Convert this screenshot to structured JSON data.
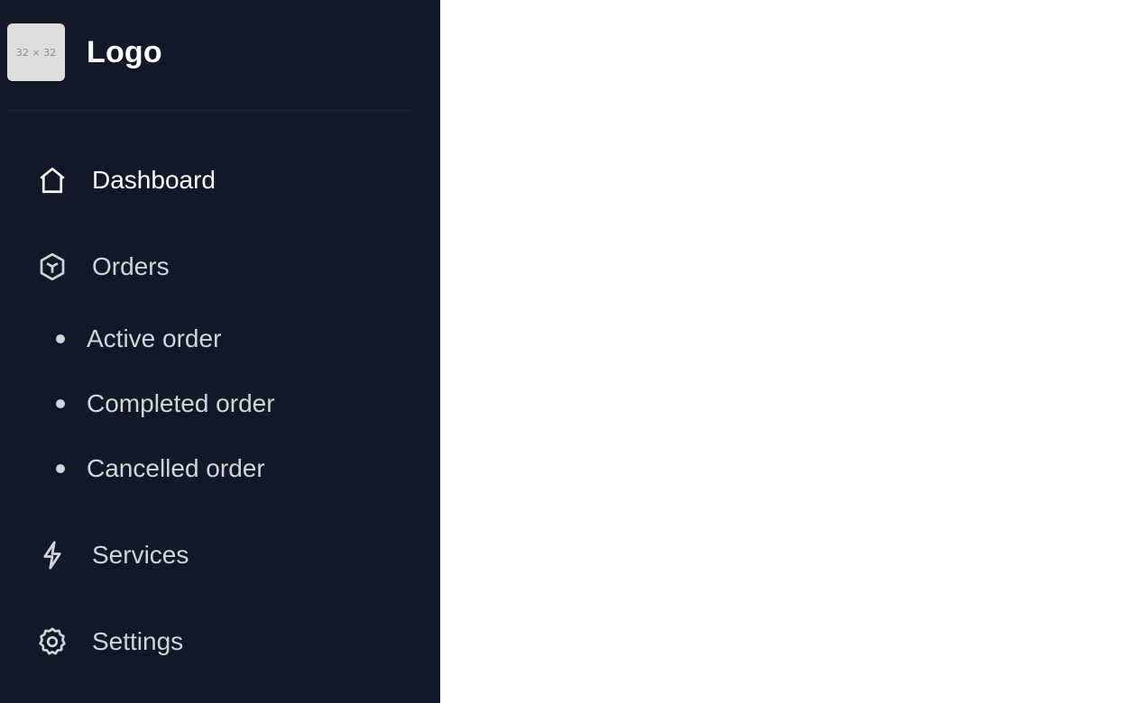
{
  "brand": {
    "logo_placeholder": "32 × 32",
    "name": "Logo"
  },
  "nav": {
    "dashboard": {
      "label": "Dashboard",
      "icon": "home-icon"
    },
    "orders": {
      "label": "Orders",
      "icon": "cube-icon"
    },
    "orders_sub": [
      {
        "label": "Active order"
      },
      {
        "label": "Completed order"
      },
      {
        "label": "Cancelled order"
      }
    ],
    "services": {
      "label": "Services",
      "icon": "bolt-icon"
    },
    "settings": {
      "label": "Settings",
      "icon": "gear-icon"
    }
  },
  "colors": {
    "sidebar_bg": "#111827",
    "text_primary": "#ffffff",
    "text_secondary": "#d1d5db"
  }
}
